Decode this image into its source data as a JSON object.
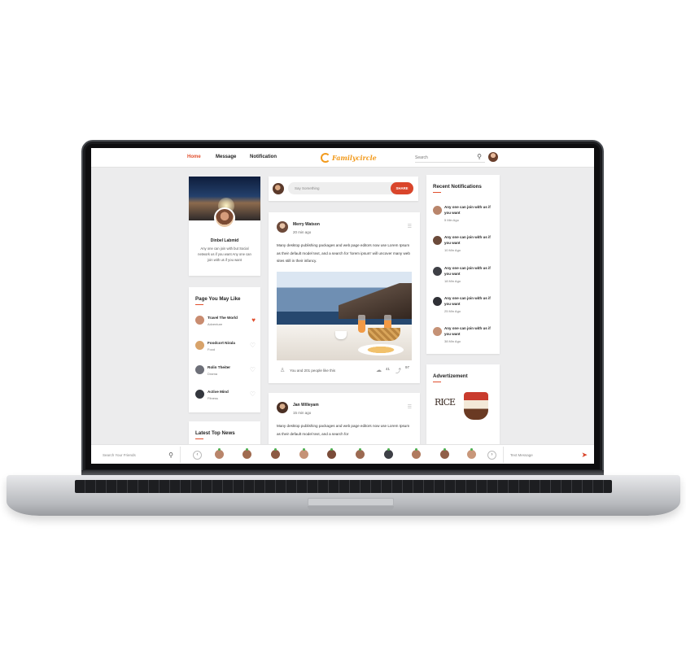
{
  "app": {
    "logo_text": "Familycircle",
    "accent_color": "#e14f2e"
  },
  "nav": {
    "home": "Home",
    "message": "Message",
    "notification": "Notification",
    "search_placeholder": "Search"
  },
  "profile": {
    "name": "Dinbel Labmid",
    "bio": "Any one can join with but Social network us if you want Any one can join with us if you want"
  },
  "pages_card": {
    "title": "Page You May Like",
    "items": [
      {
        "name": "Travel The World",
        "category": "Adventure",
        "liked": true,
        "avatar_color": "#c98c70"
      },
      {
        "name": "Foodcort Nirala",
        "category": "Food",
        "liked": false,
        "avatar_color": "#d8a36a"
      },
      {
        "name": "Rolin Theiter",
        "category": "Drama",
        "liked": false,
        "avatar_color": "#6d6f78"
      },
      {
        "name": "Active Mind",
        "category": "Fitness",
        "liked": false,
        "avatar_color": "#33363d"
      }
    ]
  },
  "news_card": {
    "title": "Latest Top News"
  },
  "composer": {
    "placeholder": "Say Something",
    "share_label": "SHARE"
  },
  "posts": [
    {
      "author": "Merry Watson",
      "time": "20 min ago",
      "text": "Many desktop publishing packages and web page editors now use Lorem Ipsum as their default model text, and a search for 'lorem ipsum' will uncover many web sites still in their infancy.",
      "likes_text": "You and 201 people like this",
      "comments": "41",
      "shares": "97"
    },
    {
      "author": "Jan Willeyam",
      "time": "15 min ago",
      "text": "Many desktop publishing packages and web page editors now use Lorem Ipsum as their default model text, and a search for"
    }
  ],
  "notifications": {
    "title": "Recent Notifications",
    "items": [
      {
        "text": "Any one can join with us if you want",
        "time": "5 Min Ago"
      },
      {
        "text": "Any one can join with us if you want",
        "time": "10 Min Ago"
      },
      {
        "text": "Any one can join with us if you want",
        "time": "18 Min Ago"
      },
      {
        "text": "Any one can join with us if you want",
        "time": "25 Min Ago"
      },
      {
        "text": "Any one can join with us if you want",
        "time": "38 Min Ago"
      }
    ]
  },
  "ads": {
    "title": "Advertizement",
    "brand": "RICE"
  },
  "chat": {
    "search_placeholder": "Search Your Friends",
    "message_placeholder": "Text Message",
    "friends": [
      "#b9856b",
      "#a06b50",
      "#8c5a43",
      "#c59276",
      "#7a4c39",
      "#9c6a52",
      "#3d3f46",
      "#b07a5f",
      "#905f48"
    ]
  }
}
